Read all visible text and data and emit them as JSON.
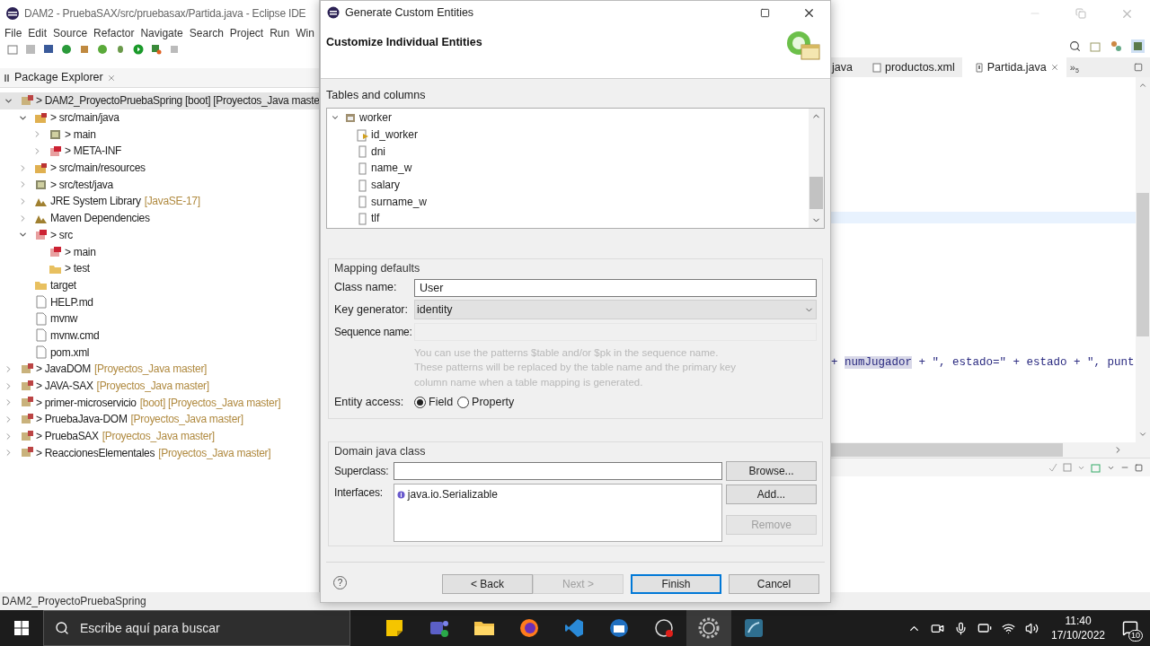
{
  "eclipse": {
    "title": "DAM2 - PruebaSAX/src/pruebasax/Partida.java - Eclipse IDE",
    "menu": [
      "File",
      "Edit",
      "Source",
      "Refactor",
      "Navigate",
      "Search",
      "Project",
      "Run",
      "Win"
    ],
    "package_explorer": {
      "title": "Package Explorer",
      "tree": [
        {
          "name": "> DAM2_ProyectoPruebaSpring [boot] [Proyectos_Java maste",
          "kind": "project",
          "selected": true,
          "expanded": true,
          "children": [
            {
              "name": "> src/main/java",
              "kind": "srcfolder",
              "selected": false,
              "expanded": true,
              "children": [
                {
                  "name": "> main",
                  "kind": "package",
                  "selected": false,
                  "expanded": false
                },
                {
                  "name": "> META-INF",
                  "kind": "redpackage",
                  "selected": false,
                  "expanded": false
                }
              ]
            },
            {
              "name": "> src/main/resources",
              "kind": "srcfolder",
              "selected": false,
              "expanded": false
            },
            {
              "name": "> src/test/java",
              "kind": "package",
              "selected": false,
              "expanded": false
            },
            {
              "name": "JRE System Library",
              "suffix": "[JavaSE-17]",
              "kind": "library",
              "selected": false,
              "expanded": false
            },
            {
              "name": "Maven Dependencies",
              "kind": "library",
              "selected": false,
              "expanded": false
            },
            {
              "name": "> src",
              "kind": "redpackage",
              "selected": false,
              "expanded": true,
              "children": [
                {
                  "name": "> main",
                  "kind": "redpackage",
                  "selected": false
                },
                {
                  "name": "> test",
                  "kind": "folder",
                  "selected": false
                }
              ]
            },
            {
              "name": "target",
              "kind": "folder",
              "selected": false
            },
            {
              "name": "HELP.md",
              "kind": "file",
              "selected": false
            },
            {
              "name": "mvnw",
              "kind": "file",
              "selected": false
            },
            {
              "name": "mvnw.cmd",
              "kind": "file",
              "selected": false
            },
            {
              "name": "pom.xml",
              "kind": "file",
              "selected": false
            }
          ]
        },
        {
          "name": "> JavaDOM",
          "suffix": "[Proyectos_Java master]",
          "kind": "project",
          "selected": false,
          "expanded": false
        },
        {
          "name": "> JAVA-SAX",
          "suffix": "[Proyectos_Java master]",
          "kind": "project",
          "selected": false,
          "expanded": false
        },
        {
          "name": "> primer-microservicio",
          "suffix": "[boot] [Proyectos_Java master]",
          "kind": "project",
          "selected": false,
          "expanded": false
        },
        {
          "name": "> PruebaJava-DOM",
          "suffix": "[Proyectos_Java master]",
          "kind": "project",
          "selected": false,
          "expanded": false
        },
        {
          "name": "> PruebaSAX",
          "suffix": "[Proyectos_Java master]",
          "kind": "project",
          "selected": false,
          "expanded": false
        },
        {
          "name": "> ReaccionesElementales",
          "suffix": "[Proyectos_Java master]",
          "kind": "project",
          "selected": false,
          "expanded": false
        }
      ]
    },
    "editor": {
      "tabs": [
        {
          "label": "java",
          "selected": false
        },
        {
          "label": "productos.xml",
          "kind": "xml",
          "selected": false
        },
        {
          "label": "Partida.java",
          "kind": "java",
          "selected": true
        }
      ],
      "overflow": "»",
      "overflow_count": "5",
      "code": [
        {
          "text": "+ ",
          "kind": "plain"
        },
        {
          "text": "numJugador",
          "kind": "highlight"
        },
        {
          "text": " + \", estado=\" + estado + \", punt",
          "kind": "plain"
        }
      ]
    },
    "status": "DAM2_ProyectoPruebaSpring"
  },
  "dialog": {
    "title": "Generate Custom Entities",
    "heading": "Customize Individual Entities",
    "tables_label": "Tables and columns",
    "tree": {
      "name": "worker",
      "expanded": true,
      "children": [
        {
          "name": "id_worker",
          "kind": "key"
        },
        {
          "name": "dni",
          "kind": "column"
        },
        {
          "name": "name_w",
          "kind": "column"
        },
        {
          "name": "salary",
          "kind": "column"
        },
        {
          "name": "surname_w",
          "kind": "column"
        },
        {
          "name": "tlf",
          "kind": "column"
        }
      ]
    },
    "mapping_defaults": {
      "legend": "Mapping defaults",
      "class_name_label": "Class name:",
      "class_name": "User",
      "key_generator_label": "Key generator:",
      "key_generator": "identity",
      "sequence_name_label": "Sequence name:",
      "hint": [
        "You can use the patterns $table and/or $pk in the sequence name.",
        "These patterns will be replaced by the table name and the primary key",
        "column name when a table mapping is generated."
      ],
      "entity_access_label": "Entity access:",
      "entity_access": [
        {
          "label": "Field",
          "selected": true
        },
        {
          "label": "Property",
          "selected": false
        }
      ]
    },
    "domain": {
      "legend": "Domain java class",
      "superclass_label": "Superclass:",
      "browse": "Browse...",
      "interfaces_label": "Interfaces:",
      "interfaces": [
        "java.io.Serializable"
      ],
      "add": "Add...",
      "remove": {
        "label": "Remove",
        "disabled": true
      }
    },
    "help": "?",
    "buttons": [
      {
        "label": "< Back",
        "disabled": false,
        "default": false
      },
      {
        "label": "Next >",
        "disabled": true,
        "default": false
      },
      {
        "label": "Finish",
        "disabled": false,
        "default": true
      },
      {
        "label": "Cancel",
        "disabled": false,
        "default": false
      }
    ]
  },
  "taskbar": {
    "search_placeholder": "Escribe aquí para buscar",
    "time": "11:40",
    "date": "17/10/2022",
    "notifications": "10"
  }
}
